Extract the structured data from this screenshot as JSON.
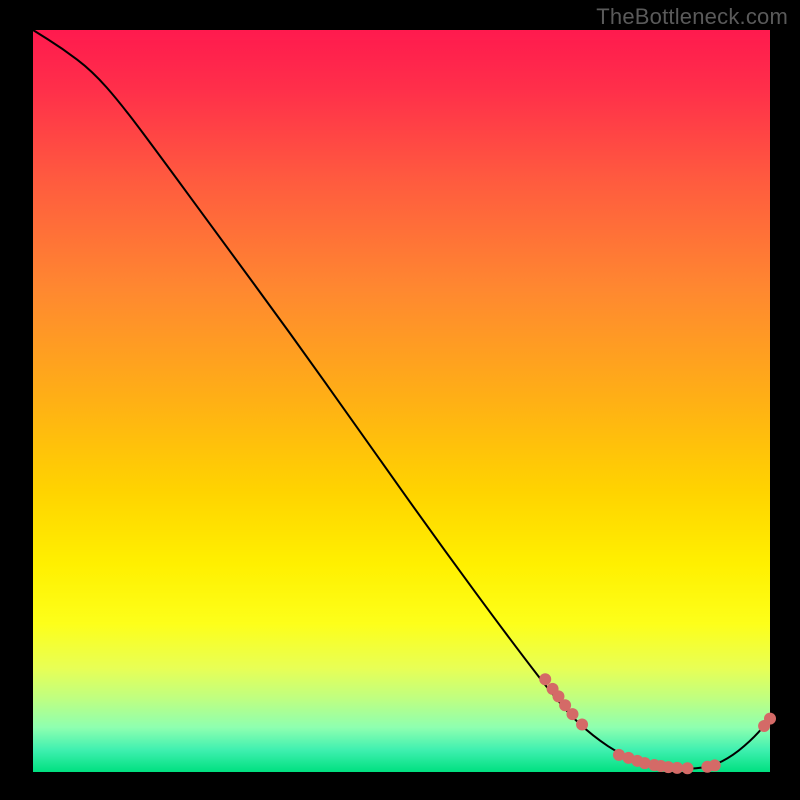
{
  "watermark": "TheBottleneck.com",
  "chart_data": {
    "type": "line",
    "title": "",
    "xlabel": "",
    "ylabel": "",
    "xlim": [
      0,
      100
    ],
    "ylim": [
      0,
      100
    ],
    "curve": [
      {
        "x": 0,
        "y": 100
      },
      {
        "x": 4,
        "y": 97.5
      },
      {
        "x": 8,
        "y": 94.5
      },
      {
        "x": 12,
        "y": 90
      },
      {
        "x": 18,
        "y": 82
      },
      {
        "x": 25,
        "y": 72.5
      },
      {
        "x": 35,
        "y": 59
      },
      {
        "x": 45,
        "y": 45
      },
      {
        "x": 55,
        "y": 31
      },
      {
        "x": 65,
        "y": 17.5
      },
      {
        "x": 72,
        "y": 8.5
      },
      {
        "x": 76,
        "y": 4.8
      },
      {
        "x": 80,
        "y": 2.2
      },
      {
        "x": 84,
        "y": 0.8
      },
      {
        "x": 88,
        "y": 0.3
      },
      {
        "x": 92,
        "y": 0.7
      },
      {
        "x": 95,
        "y": 2.2
      },
      {
        "x": 98,
        "y": 4.8
      },
      {
        "x": 100,
        "y": 7.2
      }
    ],
    "highlight_clusters": [
      {
        "points": [
          {
            "x": 69.5,
            "y": 12.5
          },
          {
            "x": 70.5,
            "y": 11.2
          },
          {
            "x": 71.3,
            "y": 10.2
          },
          {
            "x": 72.2,
            "y": 9.0
          },
          {
            "x": 73.2,
            "y": 7.8
          },
          {
            "x": 74.5,
            "y": 6.4
          }
        ]
      },
      {
        "points": [
          {
            "x": 79.5,
            "y": 2.3
          },
          {
            "x": 80.8,
            "y": 1.9
          },
          {
            "x": 82.0,
            "y": 1.5
          },
          {
            "x": 83.0,
            "y": 1.2
          },
          {
            "x": 84.3,
            "y": 0.95
          },
          {
            "x": 85.2,
            "y": 0.8
          },
          {
            "x": 86.2,
            "y": 0.65
          },
          {
            "x": 87.4,
            "y": 0.55
          },
          {
            "x": 88.8,
            "y": 0.5
          }
        ]
      },
      {
        "points": [
          {
            "x": 91.5,
            "y": 0.7
          },
          {
            "x": 92.5,
            "y": 0.9
          }
        ]
      },
      {
        "points": [
          {
            "x": 99.2,
            "y": 6.2
          },
          {
            "x": 100.0,
            "y": 7.2
          }
        ]
      }
    ],
    "marker_color": "#d46a67",
    "line_color": "#000000"
  }
}
